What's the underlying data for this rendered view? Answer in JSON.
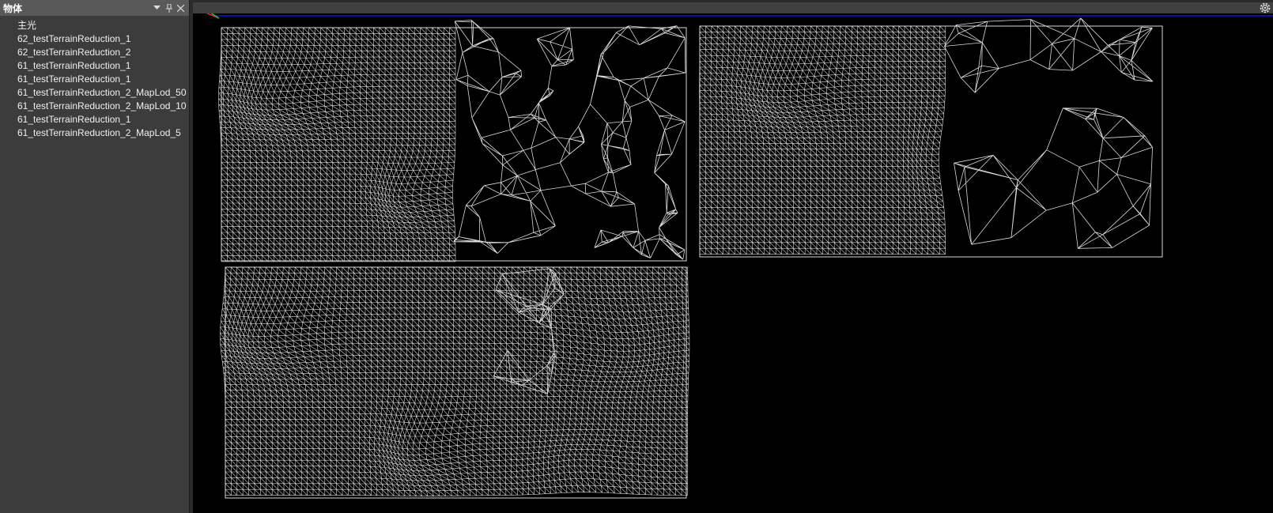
{
  "outliner": {
    "title": "物体",
    "items": [
      {
        "label": "主光"
      },
      {
        "label": "62_testTerrainReduction_1"
      },
      {
        "label": "62_testTerrainReduction_2"
      },
      {
        "label": "61_testTerrainReduction_1"
      },
      {
        "label": "61_testTerrainReduction_1"
      },
      {
        "label": "61_testTerrainReduction_2_MapLod_50"
      },
      {
        "label": "61_testTerrainReduction_2_MapLod_10"
      },
      {
        "label": "61_testTerrainReduction_1"
      },
      {
        "label": "61_testTerrainReduction_2_MapLod_5"
      }
    ],
    "header_icons": [
      "dropdown-arrow-icon",
      "pin-icon",
      "close-icon"
    ]
  },
  "viewport": {
    "background": "#000000",
    "wire_color": "#d9d9d9",
    "horizon_color": "#1a1aff",
    "axis_colors": {
      "x": "#d62828",
      "y": "#22c422"
    },
    "settings_icon": "gear-icon",
    "meshes": [
      {
        "name": "mesh-lod-top-left"
      },
      {
        "name": "mesh-lod-top-right"
      },
      {
        "name": "mesh-lod-bottom-left"
      }
    ]
  }
}
